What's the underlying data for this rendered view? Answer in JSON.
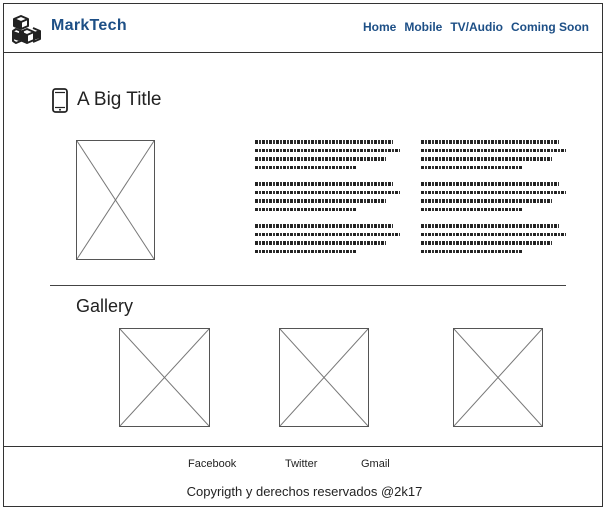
{
  "header": {
    "brand": "MarkTech",
    "logo_icon": "cubes-icon",
    "nav": [
      "Home",
      "Mobile",
      "TV/Audio",
      "Coming Soon"
    ]
  },
  "main": {
    "title_icon": "smartphone-icon",
    "title": "A Big Title",
    "gallery_title": "Gallery"
  },
  "footer": {
    "social": [
      "Facebook",
      "Twitter",
      "Gmail"
    ],
    "copyright": "Copyrigth y derechos reservados @2k17"
  },
  "colors": {
    "brand": "#1d4f86",
    "border": "#333333"
  }
}
